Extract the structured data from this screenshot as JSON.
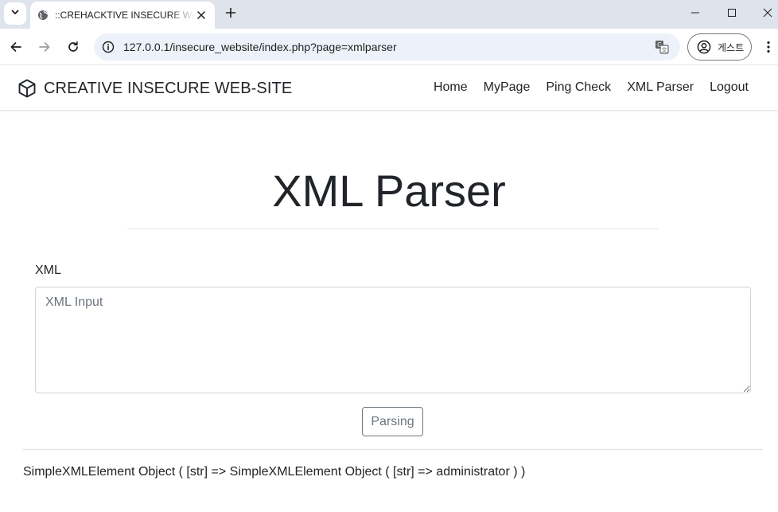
{
  "browser": {
    "tab_title": "::CREHACKTIVE INSECURE WEBSITE::",
    "url": "127.0.0.1/insecure_website/index.php?page=xmlparser",
    "profile_label": "게스트"
  },
  "icons": {
    "tab_search": "chevron-down-icon",
    "favicon": "globe-icon",
    "tab_close": "close-icon",
    "new_tab": "plus-icon",
    "minimize": "minimize-icon",
    "maximize": "maximize-icon",
    "close_window": "close-icon",
    "back": "arrow-left-icon",
    "forward": "arrow-right-icon",
    "reload": "reload-icon",
    "site_info": "info-icon",
    "translate": "translate-icon",
    "profile": "person-circle-icon",
    "menu": "kebab-menu-icon",
    "brand": "cube-icon"
  },
  "site": {
    "brand": "CREATIVE INSECURE WEB-SITE",
    "nav": [
      {
        "label": "Home"
      },
      {
        "label": "MyPage"
      },
      {
        "label": "Ping Check"
      },
      {
        "label": "XML Parser"
      },
      {
        "label": "Logout"
      }
    ]
  },
  "main": {
    "title": "XML Parser",
    "field_label": "XML",
    "textarea_placeholder": "XML Input",
    "textarea_value": "",
    "submit_label": "Parsing",
    "result": "SimpleXMLElement Object ( [str] => SimpleXMLElement Object ( [str] => administrator ) )"
  },
  "colors": {
    "tabstrip_bg": "#dfe3eb",
    "omnibox_bg": "#edf2fa",
    "text": "#212529",
    "muted": "#6c757d",
    "border": "#ced4da"
  }
}
